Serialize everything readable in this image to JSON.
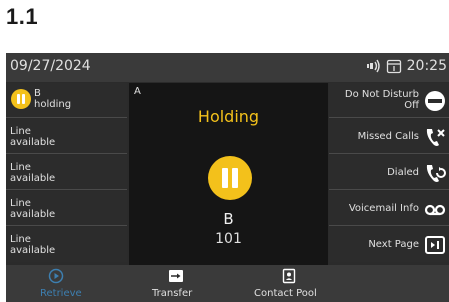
{
  "section_heading": "1.1",
  "status": {
    "date": "09/27/2024",
    "time": "20:25"
  },
  "lines": [
    {
      "line1": "B",
      "line2": "holding",
      "active": true
    },
    {
      "line1": "Line",
      "line2": "available"
    },
    {
      "line1": "Line",
      "line2": "available"
    },
    {
      "line1": "Line",
      "line2": "available"
    },
    {
      "line1": "Line",
      "line2": "available"
    }
  ],
  "call": {
    "line_letter": "A",
    "state": "Holding",
    "name": "B",
    "number": "101"
  },
  "softkeys": [
    {
      "label_line1": "Do Not Disturb",
      "label_line2": "Off",
      "icon": "dnd-icon"
    },
    {
      "label_line1": "Missed Calls",
      "label_line2": "",
      "icon": "missed-call-icon"
    },
    {
      "label_line1": "Dialed",
      "label_line2": "",
      "icon": "dialed-call-icon"
    },
    {
      "label_line1": "Voicemail Info",
      "label_line2": "",
      "icon": "voicemail-icon"
    },
    {
      "label_line1": "Next Page",
      "label_line2": "",
      "icon": "next-page-icon"
    }
  ],
  "bottom": {
    "retrieve": "Retrieve",
    "transfer": "Transfer",
    "contact_pool": "Contact Pool"
  },
  "colors": {
    "accent_hold": "#f3c11b",
    "retrieve_blue": "#3d7fb0"
  }
}
